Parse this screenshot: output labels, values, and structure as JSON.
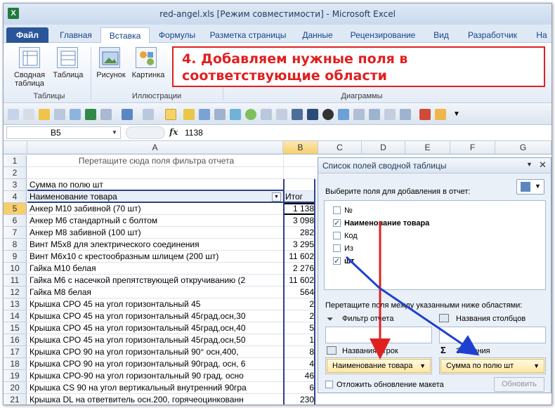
{
  "window": {
    "title": "red-angel.xls  [Режим совместимости]  -  Microsoft Excel",
    "app_icon": "X"
  },
  "tabs": [
    "Файл",
    "Главная",
    "Вставка",
    "Формулы",
    "Разметка страницы",
    "Данные",
    "Рецензирование",
    "Вид",
    "Разработчик",
    "На"
  ],
  "ribbon": {
    "pivot_label_1": "Сводная",
    "pivot_label_2": "таблица",
    "table_label": "Таблица",
    "picture_label": "Рисунок",
    "clipart_label": "Картинка",
    "group_tables": "Таблицы",
    "group_illustrations": "Иллюстрации",
    "group_charts": "Диаграммы"
  },
  "callout": {
    "text_line1": "4. Добавляем нужные поля в",
    "text_line2": "соответствующие области"
  },
  "formula_bar": {
    "name_box": "B5",
    "fx": "fx",
    "value": "1138"
  },
  "columns": [
    "A",
    "B",
    "C",
    "D",
    "E",
    "F",
    "G"
  ],
  "rows": [
    {
      "n": "1",
      "a": "Перетащите сюда поля фильтра отчета",
      "b": ""
    },
    {
      "n": "2",
      "a": "",
      "b": ""
    },
    {
      "n": "3",
      "a": "Сумма по полю шт",
      "b": ""
    },
    {
      "n": "4",
      "a": "Наименование товара",
      "b": "Итог"
    },
    {
      "n": "5",
      "a": "Анкер М10 забивной (70 шт)",
      "b": "1 138"
    },
    {
      "n": "6",
      "a": "Анкер М6 стандартный с болтом",
      "b": "3 098"
    },
    {
      "n": "7",
      "a": "Анкер М8 забивной (100 шт)",
      "b": "282"
    },
    {
      "n": "8",
      "a": "Винт М5х8 для электрического соединения",
      "b": "3 295"
    },
    {
      "n": "9",
      "a": "Винт М6х10 с крестообразным шлицем (200 шт)",
      "b": "11 602"
    },
    {
      "n": "10",
      "a": "Гайка М10 белая",
      "b": "2 276"
    },
    {
      "n": "11",
      "a": "Гайка М6 с насечкой препятствующей откручиванию (2",
      "b": "11 602"
    },
    {
      "n": "12",
      "a": "Гайка М8 белая",
      "b": "564"
    },
    {
      "n": "13",
      "a": "Крышка СРО 45 на  угол горизонтальный 45",
      "b": "2"
    },
    {
      "n": "14",
      "a": "Крышка СРО 45 на угол горизонтальный 45град,осн,30",
      "b": "2"
    },
    {
      "n": "15",
      "a": "Крышка СРО 45 на угол горизонтальный 45град,осн,40",
      "b": "5"
    },
    {
      "n": "16",
      "a": "Крышка СРО 45 на угол горизонтальный 45град,осн,50",
      "b": "1"
    },
    {
      "n": "17",
      "a": "Крышка СРО 90 на угол горизонтальный 90°  осн,400,",
      "b": "8"
    },
    {
      "n": "18",
      "a": "Крышка СРО 90 на угол горизонтальный 90град, осн, 6",
      "b": "4"
    },
    {
      "n": "19",
      "a": "Крышка СРО-90 на угол горизонтальный 90 град, осно",
      "b": "46"
    },
    {
      "n": "20",
      "a": "Крышка CS 90 на угол вертикальный внутренний 90гра",
      "b": "6"
    },
    {
      "n": "21",
      "a": "Крышка DL на ответвитель осн.200, горячеоцинкованн",
      "b": "230"
    }
  ],
  "pivot_pane": {
    "title": "Список полей сводной таблицы",
    "choose_label": "Выберите поля для добавления в отчет:",
    "fields": [
      {
        "label": "№",
        "checked": false,
        "bold": false
      },
      {
        "label": "Наименование товара",
        "checked": true,
        "bold": true
      },
      {
        "label": "Код",
        "checked": false,
        "bold": false
      },
      {
        "label": "Из",
        "checked": false,
        "bold": false
      },
      {
        "label": "шт",
        "checked": true,
        "bold": true
      }
    ],
    "drag_label": "Перетащите поля между указанными ниже областями:",
    "filter_label": "Фильтр отчета",
    "columns_label": "Названия столбцов",
    "rows_label": "Названия строк",
    "values_label": "Значения",
    "rows_item": "Наименование товара",
    "values_item": "Сумма по полю шт",
    "defer_label": "Отложить обновление макета",
    "update_button": "Обновить"
  }
}
